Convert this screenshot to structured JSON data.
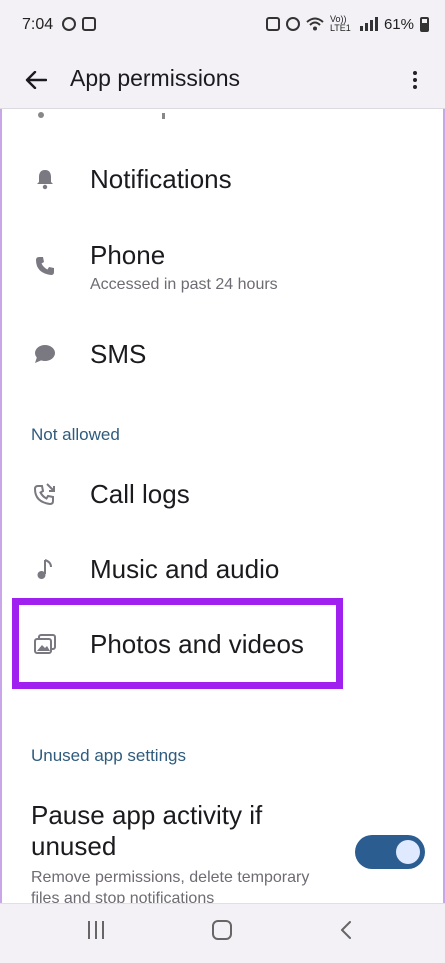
{
  "status_bar": {
    "time": "7:04",
    "network": "Vo)) LTE1",
    "battery": "61%"
  },
  "app_bar": {
    "title": "App permissions"
  },
  "allowed": [
    {
      "label": "Notifications",
      "icon": "bell-icon"
    },
    {
      "label": "Phone",
      "sub": "Accessed in past 24 hours",
      "icon": "phone-icon"
    },
    {
      "label": "SMS",
      "icon": "message-icon"
    }
  ],
  "not_allowed": {
    "header": "Not allowed",
    "items": [
      {
        "label": "Call logs",
        "icon": "call-log-icon"
      },
      {
        "label": "Music and audio",
        "icon": "music-note-icon"
      },
      {
        "label": "Photos and videos",
        "icon": "image-icon"
      }
    ]
  },
  "unused": {
    "header": "Unused app settings",
    "pause_title": "Pause app activity if unused",
    "pause_desc": "Remove permissions, delete temporary files and stop notifications",
    "toggle_on": true
  },
  "colors": {
    "accent": "#2b5d91",
    "section_header": "#2f5b7d",
    "highlight": "#a020f0"
  }
}
